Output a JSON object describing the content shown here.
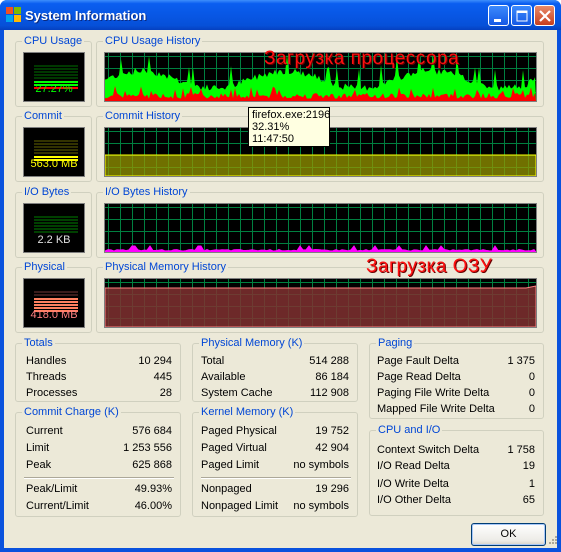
{
  "window": {
    "title": "System Information"
  },
  "panels": {
    "cpu_usage": {
      "label": "CPU Usage",
      "value": "27.27%"
    },
    "cpu_history": {
      "label": "CPU Usage History",
      "annotation": "Загрузка процессора"
    },
    "commit": {
      "label": "Commit",
      "value": "563.0 MB"
    },
    "commit_history": {
      "label": "Commit History"
    },
    "io_bytes": {
      "label": "I/O Bytes",
      "value": "2.2  KB"
    },
    "io_history": {
      "label": "I/O Bytes History"
    },
    "physical": {
      "label": "Physical",
      "value": "418.0 MB"
    },
    "physical_history": {
      "label": "Physical Memory History",
      "annotation": "Загрузка ОЗУ"
    }
  },
  "tooltip": {
    "line1": "firefox.exe:2196",
    "line2": "32.31%",
    "line3": "11:47:50"
  },
  "totals": {
    "label": "Totals",
    "rows": [
      {
        "k": "Handles",
        "v": "10 294"
      },
      {
        "k": "Threads",
        "v": "445"
      },
      {
        "k": "Processes",
        "v": "28"
      }
    ]
  },
  "commit_charge": {
    "label": "Commit Charge (K)",
    "rows": [
      {
        "k": "Current",
        "v": "576 684"
      },
      {
        "k": "Limit",
        "v": "1 253 556"
      },
      {
        "k": "Peak",
        "v": "625 868"
      },
      {
        "k": "Peak/Limit",
        "v": "49.93%"
      },
      {
        "k": "Current/Limit",
        "v": "46.00%"
      }
    ]
  },
  "physical_memory": {
    "label": "Physical Memory (K)",
    "rows": [
      {
        "k": "Total",
        "v": "514 288"
      },
      {
        "k": "Available",
        "v": "86 184"
      },
      {
        "k": "System Cache",
        "v": "112 908"
      }
    ]
  },
  "kernel_memory": {
    "label": "Kernel Memory (K)",
    "rows": [
      {
        "k": "Paged Physical",
        "v": "19 752"
      },
      {
        "k": "Paged Virtual",
        "v": "42 904"
      },
      {
        "k": "Paged Limit",
        "v": "no symbols"
      },
      {
        "k": "Nonpaged",
        "v": "19 296"
      },
      {
        "k": "Nonpaged Limit",
        "v": "no symbols"
      }
    ]
  },
  "paging": {
    "label": "Paging",
    "rows": [
      {
        "k": "Page Fault Delta",
        "v": "1 375"
      },
      {
        "k": "Page Read Delta",
        "v": "0"
      },
      {
        "k": "Paging File Write Delta",
        "v": "0"
      },
      {
        "k": "Mapped File Write Delta",
        "v": "0"
      }
    ]
  },
  "cpu_io": {
    "label": "CPU and I/O",
    "rows": [
      {
        "k": "Context Switch Delta",
        "v": "1 758"
      },
      {
        "k": "I/O Read Delta",
        "v": "19"
      },
      {
        "k": "I/O Write Delta",
        "v": "1"
      },
      {
        "k": "I/O Other Delta",
        "v": "65"
      }
    ]
  },
  "buttons": {
    "ok": "OK"
  },
  "colors": {
    "cpu": "#00ff00",
    "cpu_kernel": "#ff0000",
    "commit": "#ffff00",
    "io": "#ff00ff",
    "physical": "#ff8080",
    "grid": "#008040"
  }
}
